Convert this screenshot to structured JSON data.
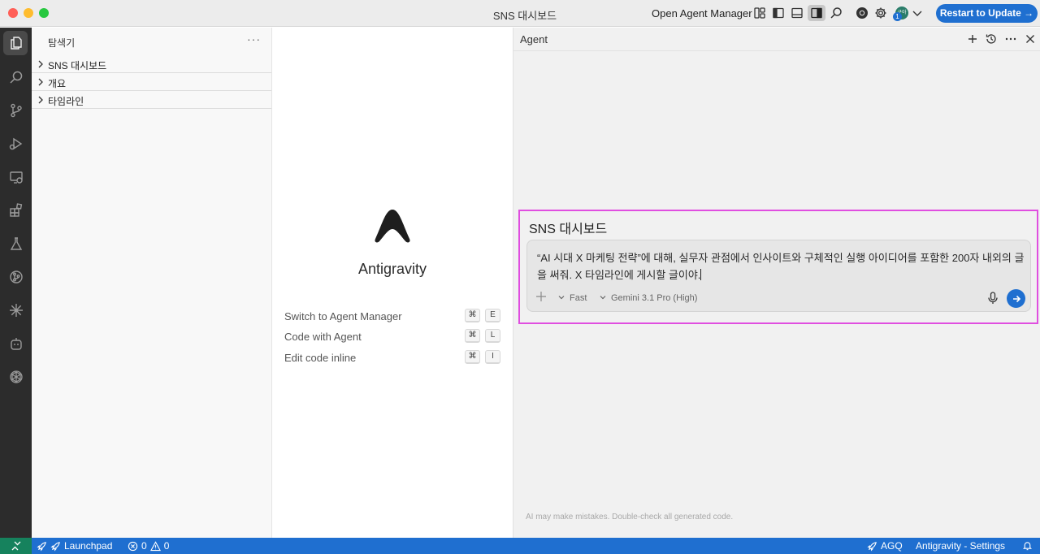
{
  "window": {
    "title": "SNS 대시보드"
  },
  "titlebar": {
    "open_agent_manager": "Open Agent Manager",
    "avatar_initials": "구아",
    "avatar_badge": "1",
    "restart_button": "Restart to Update →",
    "icons": [
      "layout-customize-icon",
      "toggle-primary-sidebar-icon",
      "toggle-panel-icon",
      "toggle-secondary-sidebar-icon",
      "search-icon",
      "chrome-icon",
      "gear-icon",
      "account-avatar",
      "chevron-down-icon"
    ]
  },
  "activitybar": {
    "items": [
      "explorer-icon",
      "search-icon",
      "source-control-icon",
      "run-debug-icon",
      "remote-explorer-icon",
      "extensions-icon",
      "testing-icon",
      "git-graph-icon",
      "sparkle-icon",
      "robot-icon",
      "openai-icon"
    ]
  },
  "sidebar": {
    "title": "탐색기",
    "more": "···",
    "sections": [
      {
        "label": "SNS 대시보드"
      },
      {
        "label": "개요"
      },
      {
        "label": "타임라인"
      }
    ]
  },
  "welcome": {
    "app_name": "Antigravity",
    "shortcuts": [
      {
        "label": "Switch to Agent Manager",
        "mod": "⌘",
        "key": "E"
      },
      {
        "label": "Code with Agent",
        "mod": "⌘",
        "key": "L"
      },
      {
        "label": "Edit code inline",
        "mod": "⌘",
        "key": "I"
      }
    ]
  },
  "agent": {
    "title": "Agent",
    "conversation_title": "SNS 대시보드",
    "prompt": "“AI 시대 X 마케팅 전략”에 대해, 실무자 관점에서 인사이트와 구체적인 실행 아이디어를 포함한 200자 내외의 글을 써줘. X 타임라인에 게시할 글이야.",
    "mode": "Fast",
    "model": "Gemini 3.1 Pro (High)",
    "disclaimer": "AI may make mistakes. Double-check all generated code."
  },
  "statusbar": {
    "launchpad": "Launchpad",
    "errors": "0",
    "warnings": "0",
    "agq": "AGQ",
    "settings": "Antigravity - Settings"
  },
  "colors": {
    "accent": "#1f6fd0",
    "remote_indicator": "#16825d",
    "highlight_border": "#e04ee0",
    "activitybar_bg": "#2c2c2c"
  }
}
